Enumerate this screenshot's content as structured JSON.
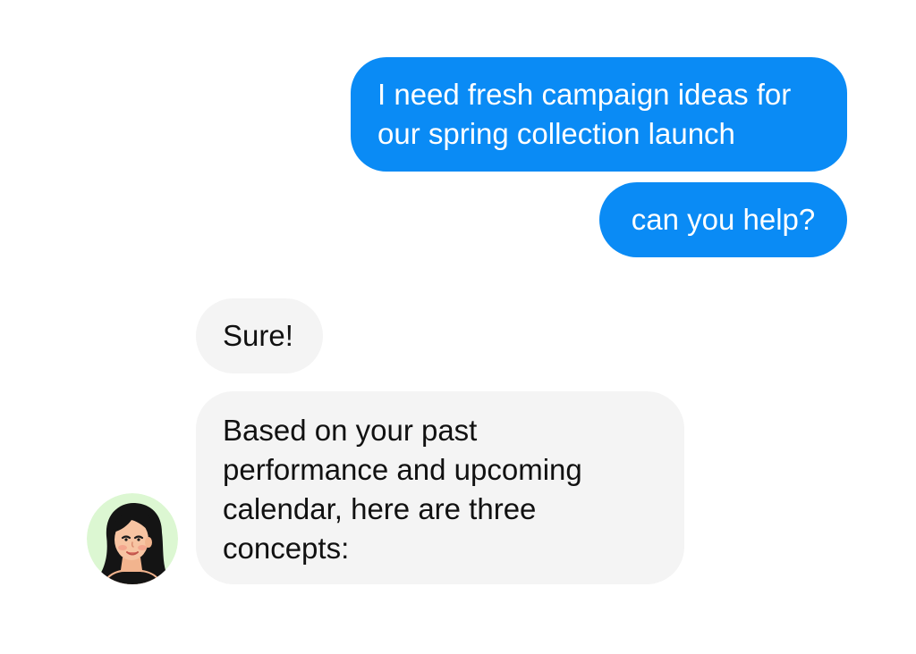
{
  "messages": [
    {
      "sender": "user",
      "lines": [
        "I need fresh campaign ideas for",
        "our spring collection launch"
      ]
    },
    {
      "sender": "user",
      "lines": [
        "can you help?"
      ]
    },
    {
      "sender": "assistant",
      "lines": [
        "Sure!"
      ]
    },
    {
      "sender": "assistant",
      "lines": [
        "Based on your past",
        "performance and upcoming",
        "calendar, here are three",
        "concepts:"
      ]
    }
  ],
  "assistant_avatar": {
    "icon": "woman-avatar-icon",
    "background_color": "#dcf7d2"
  },
  "colors": {
    "outgoing_bubble": "#0a8bf5",
    "incoming_bubble": "#f4f4f4",
    "outgoing_text": "#ffffff",
    "incoming_text": "#111111"
  }
}
